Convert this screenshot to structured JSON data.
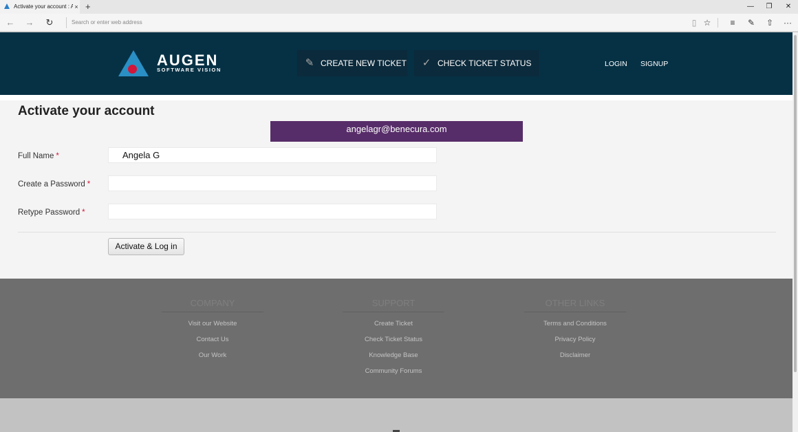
{
  "browser": {
    "tab_title": "Activate your account : A",
    "tab_close": "×",
    "new_tab": "+",
    "address_placeholder": "Search or enter web address",
    "controls": {
      "minimize": "—",
      "restore": "❐",
      "close": "✕"
    },
    "nav": {
      "back": "←",
      "forward": "→",
      "refresh": "↻"
    },
    "toolbar": {
      "reading": "▯",
      "favorite": "☆",
      "hub": "≡",
      "note": "✎",
      "share": "⇧",
      "more": "···"
    }
  },
  "header": {
    "logo_word": "AUGEN",
    "logo_tagline": "SOFTWARE VISION",
    "create_ticket": "CREATE NEW TICKET",
    "create_ticket_icon": "pencil-icon",
    "check_status": "CHECK TICKET STATUS",
    "check_status_icon": "check-icon",
    "login": "LOGIN",
    "signup": "SIGNUP",
    "colors": {
      "background": "#063145",
      "button": "#0b2a3b",
      "logo_blue": "#2a8fc4",
      "logo_red": "#d3163a"
    }
  },
  "form": {
    "title": "Activate your account",
    "email": "angelagr@benecura.com",
    "required_mark": "*",
    "fields": [
      {
        "label": "Full Name",
        "value": "Angela G"
      },
      {
        "label": "Create a Password",
        "value": ""
      },
      {
        "label": "Retype Password",
        "value": ""
      }
    ],
    "submit_label": "Activate & Log in",
    "colors": {
      "banner": "#572d69",
      "required": "#d3163a"
    }
  },
  "footer": {
    "columns": [
      {
        "title": "COMPANY",
        "links": [
          "Visit our Website",
          "Contact Us",
          "Our Work"
        ]
      },
      {
        "title": "SUPPORT",
        "links": [
          "Create Ticket",
          "Check Ticket Status",
          "Knowledge Base",
          "Community Forums"
        ]
      },
      {
        "title": "OTHER LINKS",
        "links": [
          "Terms and Conditions",
          "Privacy Policy",
          "Disclaimer"
        ]
      }
    ]
  }
}
